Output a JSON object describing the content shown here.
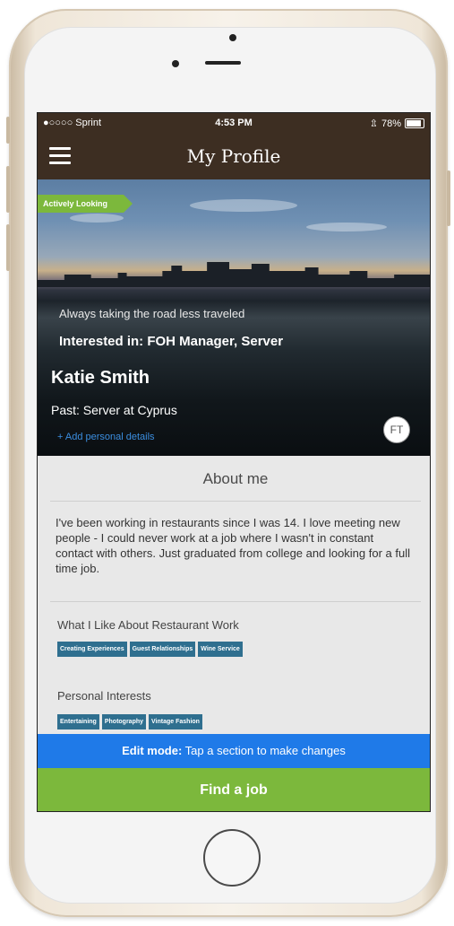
{
  "status_bar": {
    "carrier": "●○○○○ Sprint",
    "time": "4:53 PM",
    "battery": "78%",
    "battery_level": 0.78
  },
  "nav": {
    "title": "My Profile",
    "menu_icon": "hamburger-menu-icon"
  },
  "hero": {
    "badge": "Actively Looking",
    "tagline": "Always taking the road less traveled",
    "interested": "Interested in: FOH Manager, Server",
    "name": "Katie Smith",
    "past": "Past: Server at Cyprus",
    "add_details": "+ Add personal details",
    "avatar_initials": "FT"
  },
  "about": {
    "title": "About me",
    "text": "I've been working in restaurants since I was 14. I love meeting new people - I could never work at a job where I wasn't in constant contact with others. Just graduated from college and looking for a full time job."
  },
  "likes": {
    "title": "What I Like About Restaurant Work",
    "tags": [
      "Creating Experiences",
      "Guest Relationships",
      "Wine Service"
    ]
  },
  "interests": {
    "title": "Personal Interests",
    "tags": [
      "Entertaining",
      "Photography",
      "Vintage Fashion"
    ]
  },
  "edit_bar": {
    "bold": "Edit mode:",
    "text": " Tap a section to make changes"
  },
  "cta": {
    "label": "Find a job"
  },
  "colors": {
    "header_brown": "#3d2e22",
    "accent_green": "#7cb83c",
    "edit_blue": "#1f7ae8",
    "tag_teal": "#2f6f8f"
  }
}
